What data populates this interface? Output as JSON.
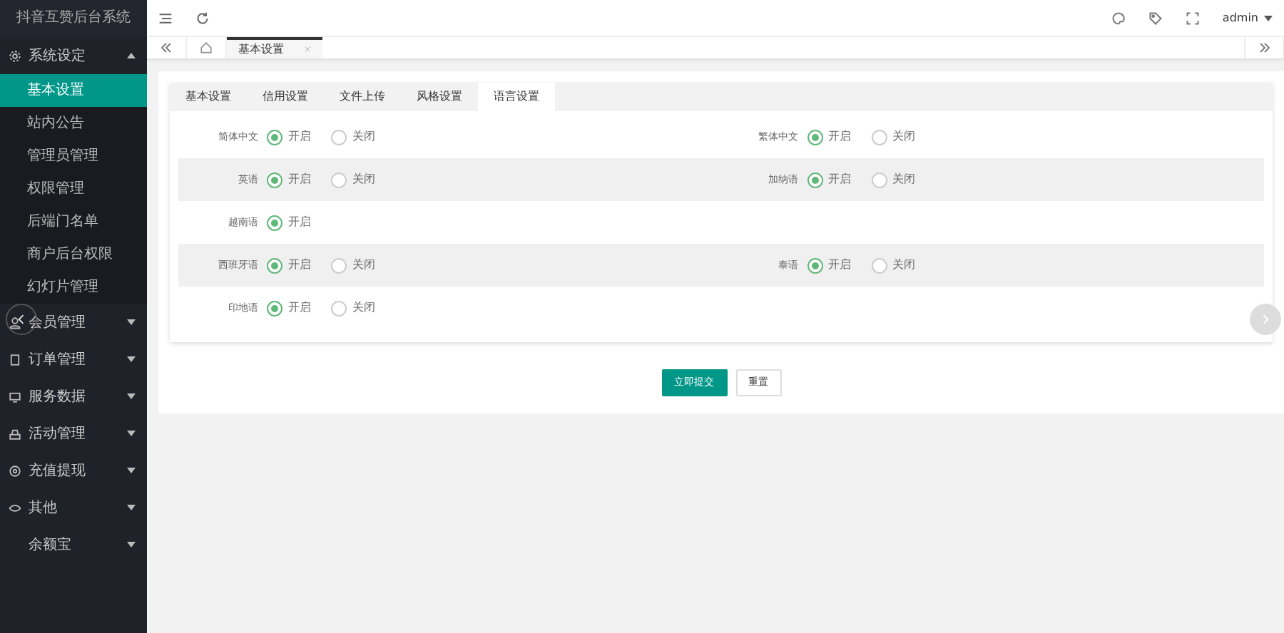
{
  "sidebar": {
    "title": "抖音互赞后台系统",
    "groups": [
      {
        "label": "系统设定",
        "expanded": true,
        "children": [
          {
            "label": "基本设置",
            "selected": true
          },
          {
            "label": "站内公告",
            "selected": false
          },
          {
            "label": "管理员管理",
            "selected": false
          },
          {
            "label": "权限管理",
            "selected": false
          },
          {
            "label": "后端门名单",
            "selected": false
          },
          {
            "label": "商户后台权限",
            "selected": false
          },
          {
            "label": "幻灯片管理",
            "selected": false
          }
        ]
      },
      {
        "label": "会员管理",
        "expanded": false
      },
      {
        "label": "订单管理",
        "expanded": false
      },
      {
        "label": "服务数据",
        "expanded": false
      },
      {
        "label": "活动管理",
        "expanded": false
      },
      {
        "label": "充值提现",
        "expanded": false
      },
      {
        "label": "其他",
        "expanded": false
      },
      {
        "label": "余额宝",
        "expanded": false
      }
    ]
  },
  "header": {
    "user": "admin"
  },
  "page_tabs": [
    {
      "label": "基本设置",
      "selected": true
    }
  ],
  "form_tabs": [
    {
      "label": "基本设置",
      "selected": false
    },
    {
      "label": "信用设置",
      "selected": false
    },
    {
      "label": "文件上传",
      "selected": false
    },
    {
      "label": "风格设置",
      "selected": false
    },
    {
      "label": "语言设置",
      "selected": true
    }
  ],
  "rows": [
    {
      "items": [
        {
          "label": "简体中文",
          "options": [
            {
              "text": "开启",
              "selected": true
            },
            {
              "text": "关闭",
              "selected": false
            }
          ]
        },
        {
          "label": "繁体中文",
          "options": [
            {
              "text": "开启",
              "selected": true
            },
            {
              "text": "关闭",
              "selected": false
            }
          ]
        }
      ]
    },
    {
      "items": [
        {
          "label": "英语",
          "options": [
            {
              "text": "开启",
              "selected": true
            },
            {
              "text": "关闭",
              "selected": false
            }
          ]
        },
        {
          "label": "加纳语",
          "options": [
            {
              "text": "开启",
              "selected": true
            },
            {
              "text": "关闭",
              "selected": false
            }
          ]
        }
      ]
    },
    {
      "items": [
        {
          "label": "越南语",
          "options": [
            {
              "text": "开启",
              "selected": true
            }
          ]
        }
      ]
    },
    {
      "items": [
        {
          "label": "西班牙语",
          "options": [
            {
              "text": "开启",
              "selected": true
            },
            {
              "text": "关闭",
              "selected": false
            }
          ]
        },
        {
          "label": "泰语",
          "options": [
            {
              "text": "开启",
              "selected": true
            },
            {
              "text": "关闭",
              "selected": false
            }
          ]
        }
      ]
    },
    {
      "items": [
        {
          "label": "印地语",
          "options": [
            {
              "text": "开启",
              "selected": true
            },
            {
              "text": "关闭",
              "selected": false
            }
          ]
        }
      ]
    }
  ],
  "buttons": [
    {
      "label": "立即提交",
      "kind": "primary"
    },
    {
      "label": "重置",
      "kind": "secondary"
    }
  ]
}
